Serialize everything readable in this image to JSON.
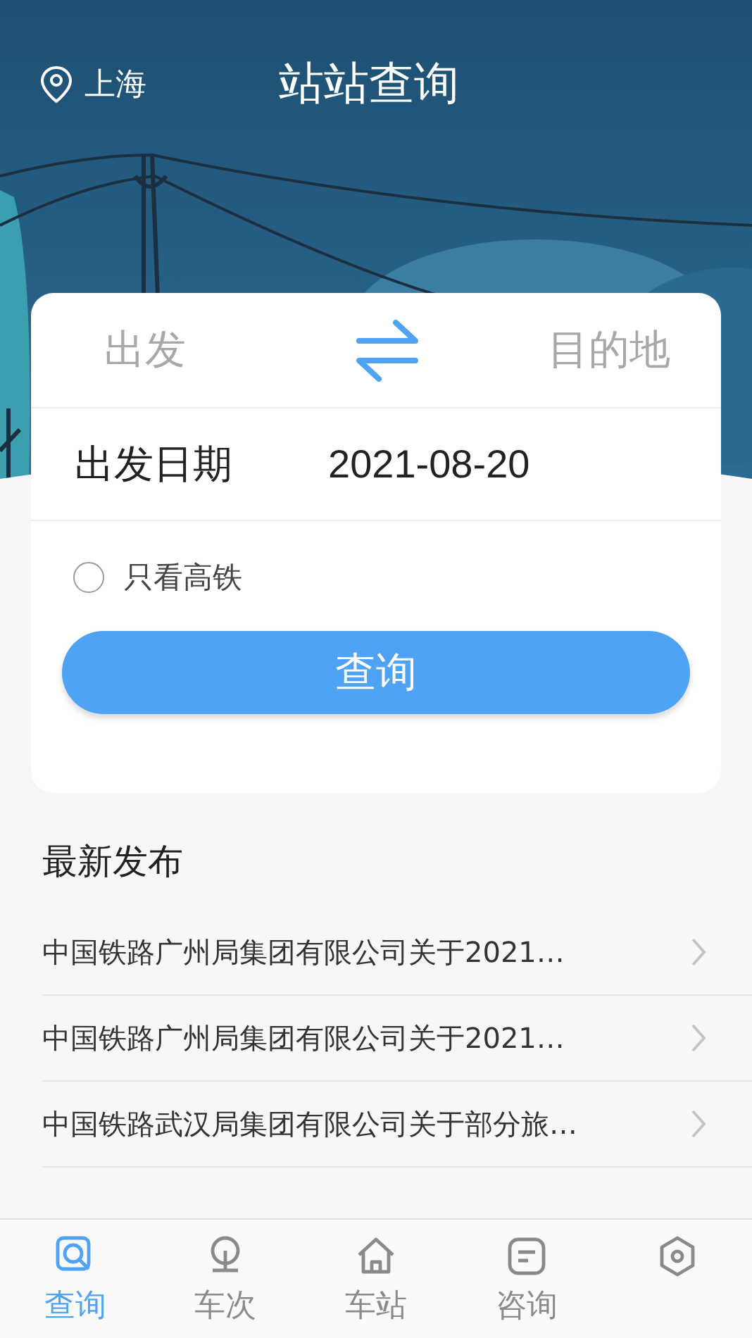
{
  "header": {
    "city": "上海",
    "title": "站站查询"
  },
  "search_card": {
    "from_placeholder": "出发",
    "to_placeholder": "目的地",
    "date_label": "出发日期",
    "date_value": "2021-08-20",
    "high_speed_only": {
      "label": "只看高铁",
      "checked": false
    },
    "button": "查询"
  },
  "news": {
    "title": "最新发布",
    "items": [
      {
        "text": "中国铁路广州局集团有限公司关于2021…"
      },
      {
        "text": "中国铁路广州局集团有限公司关于2021…"
      },
      {
        "text": "中国铁路武汉局集团有限公司关于部分旅…"
      }
    ]
  },
  "tab_bar": [
    {
      "kind": "search",
      "label": "查询",
      "selected": true
    },
    {
      "kind": "train",
      "label": "车次",
      "selected": false
    },
    {
      "kind": "station",
      "label": "车站",
      "selected": false
    },
    {
      "kind": "info",
      "label": "咨询",
      "selected": false
    },
    {
      "kind": "profile",
      "selected": false
    }
  ]
}
